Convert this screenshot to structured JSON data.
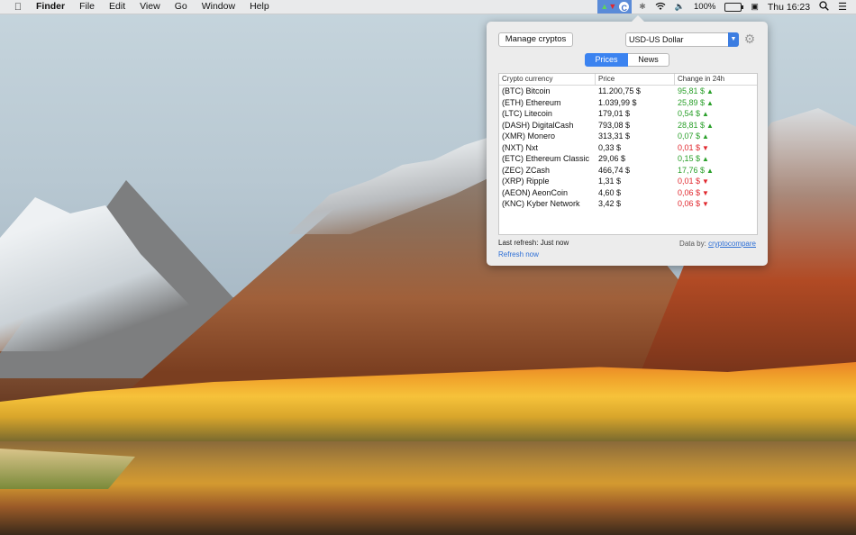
{
  "menubar": {
    "app_name": "Finder",
    "menus": [
      "File",
      "Edit",
      "View",
      "Go",
      "Window",
      "Help"
    ],
    "status": {
      "battery_percent": "100%",
      "battery_icon_text": "",
      "clock": "Thu 16:23"
    }
  },
  "popover": {
    "manage_button": "Manage cryptos",
    "currency_select": "USD-US Dollar",
    "tabs": {
      "prices": "Prices",
      "news": "News",
      "active": "Prices"
    },
    "table": {
      "headers": {
        "name": "Crypto currency",
        "price": "Price",
        "change": "Change in 24h"
      },
      "rows": [
        {
          "name": "(BTC) Bitcoin",
          "price": "11.200,75 $",
          "change": "95,81 $",
          "dir": "up"
        },
        {
          "name": "(ETH) Ethereum",
          "price": "1.039,99 $",
          "change": "25,89 $",
          "dir": "up"
        },
        {
          "name": "(LTC) Litecoin",
          "price": "179,01 $",
          "change": "0,54 $",
          "dir": "up"
        },
        {
          "name": "(DASH) DigitalCash",
          "price": "793,08 $",
          "change": "28,81 $",
          "dir": "up"
        },
        {
          "name": "(XMR) Monero",
          "price": "313,31 $",
          "change": "0,07 $",
          "dir": "up"
        },
        {
          "name": "(NXT) Nxt",
          "price": "0,33 $",
          "change": "0,01 $",
          "dir": "down"
        },
        {
          "name": "(ETC) Ethereum Classic",
          "price": "29,06 $",
          "change": "0,15 $",
          "dir": "up"
        },
        {
          "name": "(ZEC) ZCash",
          "price": "466,74 $",
          "change": "17,76 $",
          "dir": "up"
        },
        {
          "name": "(XRP) Ripple",
          "price": "1,31 $",
          "change": "0,01 $",
          "dir": "down"
        },
        {
          "name": "(AEON) AeonCoin",
          "price": "4,60 $",
          "change": "0,06 $",
          "dir": "down"
        },
        {
          "name": "(KNC) Kyber Network",
          "price": "3,42 $",
          "change": "0,06 $",
          "dir": "down"
        }
      ]
    },
    "last_refresh": "Last refresh: Just now",
    "refresh_now": "Refresh now",
    "data_by_label": "Data by:",
    "data_by_link": "cryptocompare"
  },
  "colors": {
    "up": "#2ba02b",
    "down": "#e0282e",
    "accent": "#3b83f0"
  },
  "icons": [
    "apple-icon",
    "crypto-menubar-icon",
    "bluetooth-icon",
    "wifi-icon",
    "volume-icon",
    "battery-icon",
    "display-icon",
    "search-icon",
    "list-icon",
    "gear-icon",
    "dropdown-arrow-icon"
  ]
}
